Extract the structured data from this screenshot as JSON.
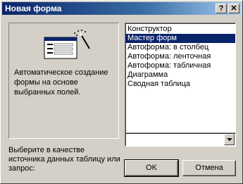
{
  "window": {
    "title": "Новая форма",
    "help_label": "?",
    "close_label": "✕"
  },
  "preview": {
    "description": "Автоматическое создание формы на основе выбранных полей."
  },
  "list": {
    "items": [
      {
        "label": "Конструктор",
        "selected": false
      },
      {
        "label": "Мастер форм",
        "selected": true
      },
      {
        "label": "Автоформа: в столбец",
        "selected": false
      },
      {
        "label": "Автоформа: ленточная",
        "selected": false
      },
      {
        "label": "Автоформа: табличная",
        "selected": false
      },
      {
        "label": "Диаграмма",
        "selected": false
      },
      {
        "label": "Сводная таблица",
        "selected": false
      }
    ]
  },
  "source": {
    "label": "Выберите в качестве источника данных таблицу или запрос:",
    "value": ""
  },
  "buttons": {
    "ok": "OK",
    "cancel": "Отмена"
  },
  "colors": {
    "selection": "#0a246a",
    "face": "#d4d0c8"
  }
}
